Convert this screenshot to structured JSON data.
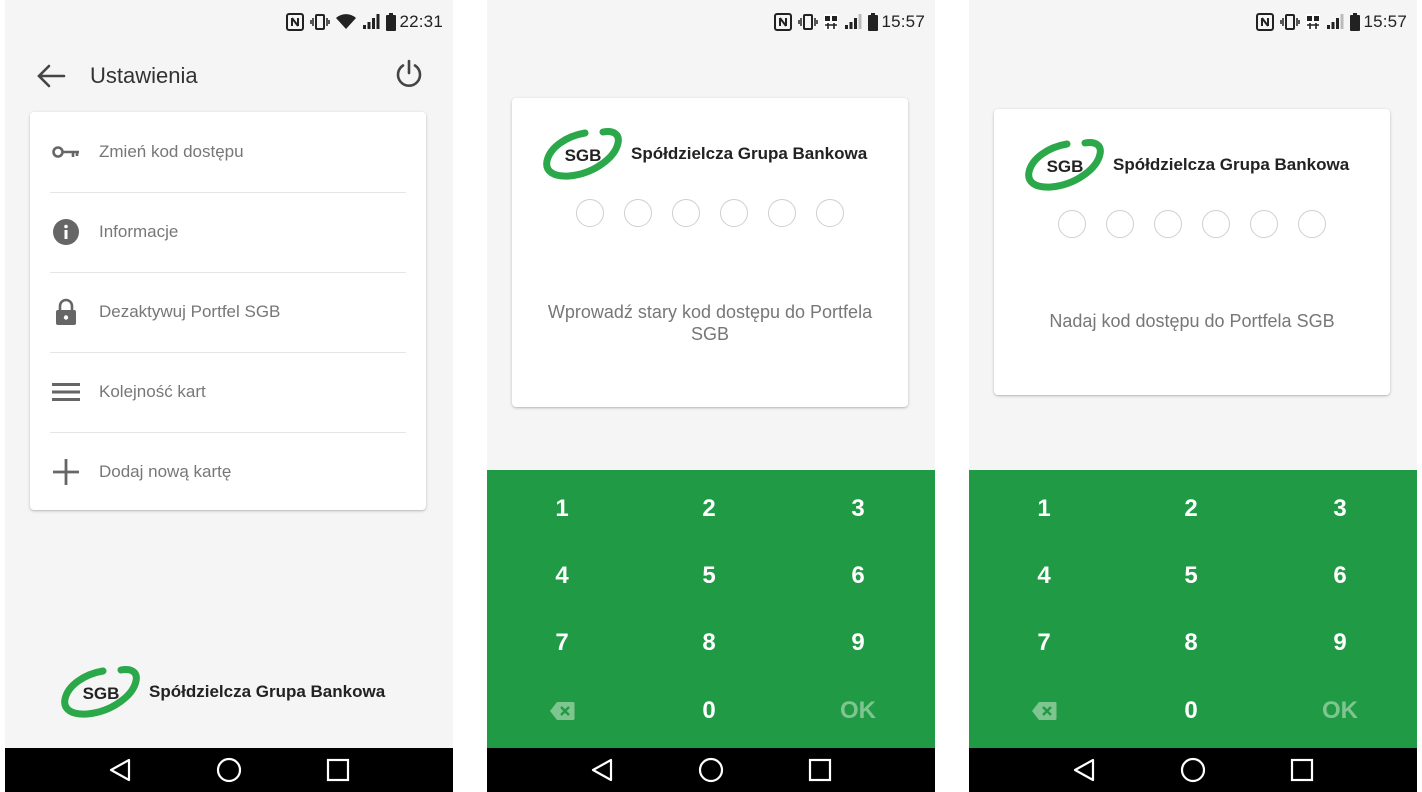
{
  "colors": {
    "brand_green": "#209a44",
    "keypad_ok": "#7fc590",
    "text_gray": "#777777"
  },
  "brand": {
    "logo_text": "SGB",
    "name": "Spółdzielcza Grupa Bankowa"
  },
  "screen_settings": {
    "status_time": "22:31",
    "title": "Ustawienia",
    "menu": [
      {
        "icon": "key-icon",
        "label": "Zmień kod dostępu"
      },
      {
        "icon": "info-icon",
        "label": "Informacje"
      },
      {
        "icon": "lock-icon",
        "label": "Dezaktywuj Portfel SGB"
      },
      {
        "icon": "menu-lines-icon",
        "label": "Kolejność kart"
      },
      {
        "icon": "plus-icon",
        "label": "Dodaj nową kartę"
      }
    ]
  },
  "screen_old_pin": {
    "status_time": "15:57",
    "prompt": "Wprowadź stary kod dostępu do Portfela SGB",
    "keys": {
      "k1": "1",
      "k2": "2",
      "k3": "3",
      "k4": "4",
      "k5": "5",
      "k6": "6",
      "k7": "7",
      "k8": "8",
      "k9": "9",
      "k0": "0",
      "ok": "OK"
    }
  },
  "screen_new_pin": {
    "status_time": "15:57",
    "prompt": "Nadaj kod dostępu do Portfela SGB",
    "keys": {
      "k1": "1",
      "k2": "2",
      "k3": "3",
      "k4": "4",
      "k5": "5",
      "k6": "6",
      "k7": "7",
      "k8": "8",
      "k9": "9",
      "k0": "0",
      "ok": "OK"
    }
  }
}
